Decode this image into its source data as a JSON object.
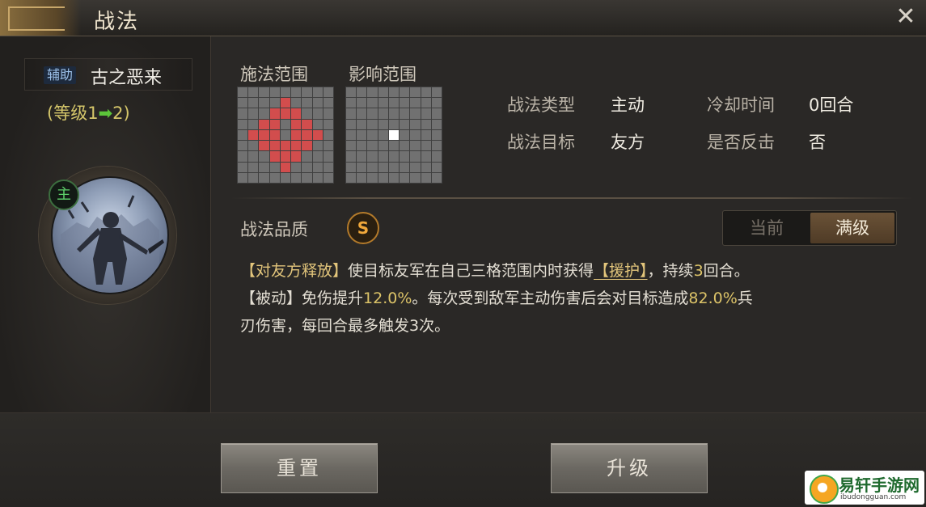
{
  "window": {
    "title": "战法",
    "close_label": "✕"
  },
  "hero": {
    "role": "辅助",
    "name": "古之恶来",
    "level_prefix": "(等级1",
    "level_arrow": "➡",
    "level_suffix": "2)",
    "main_badge": "主"
  },
  "range": {
    "cast_label": "施法范围",
    "effect_label": "影响范围",
    "cast_cells": [
      [
        1,
        4
      ],
      [
        2,
        3
      ],
      [
        2,
        4
      ],
      [
        2,
        5
      ],
      [
        3,
        2
      ],
      [
        3,
        3
      ],
      [
        3,
        5
      ],
      [
        3,
        6
      ],
      [
        4,
        1
      ],
      [
        4,
        2
      ],
      [
        4,
        3
      ],
      [
        4,
        5
      ],
      [
        4,
        6
      ],
      [
        4,
        7
      ],
      [
        5,
        2
      ],
      [
        5,
        3
      ],
      [
        5,
        4
      ],
      [
        5,
        5
      ],
      [
        5,
        6
      ],
      [
        6,
        3
      ],
      [
        6,
        4
      ],
      [
        6,
        5
      ],
      [
        7,
        4
      ]
    ],
    "effect_cells": [
      [
        4,
        4
      ]
    ]
  },
  "info": {
    "type_label": "战法类型",
    "type_value": "主动",
    "target_label": "战法目标",
    "target_value": "友方",
    "cooldown_label": "冷却时间",
    "cooldown_value": "0回合",
    "counter_label": "是否反击",
    "counter_value": "否"
  },
  "quality": {
    "label": "战法品质",
    "grade": "S"
  },
  "toggle": {
    "current": "当前",
    "max": "满级"
  },
  "description": {
    "l1_tag": "【对友方释放】",
    "l1_a": "使目标友军在自己三格范围内时获得",
    "l1_hl": "【援护】",
    "l1_b": "，持续",
    "l1_num": "3",
    "l1_c": "回合。",
    "l2_tag": "【被动】",
    "l2_a": "免伤提升",
    "l2_num1": "12.0%",
    "l2_b": "。每次受到敌军主动伤害后会对目标造成",
    "l2_num2": "82.0%",
    "l2_c": "兵",
    "l3": "刃伤害，每回合最多触发3次。"
  },
  "buttons": {
    "reset": "重置",
    "upgrade": "升级"
  },
  "watermark": {
    "title": "易轩手游网",
    "url": "ibudongguan.com"
  },
  "colors": {
    "accent_gold": "#e2c57b",
    "range_red": "#d24d4d",
    "level_green": "#5cc53a",
    "quality_orange": "#f0a83b"
  }
}
